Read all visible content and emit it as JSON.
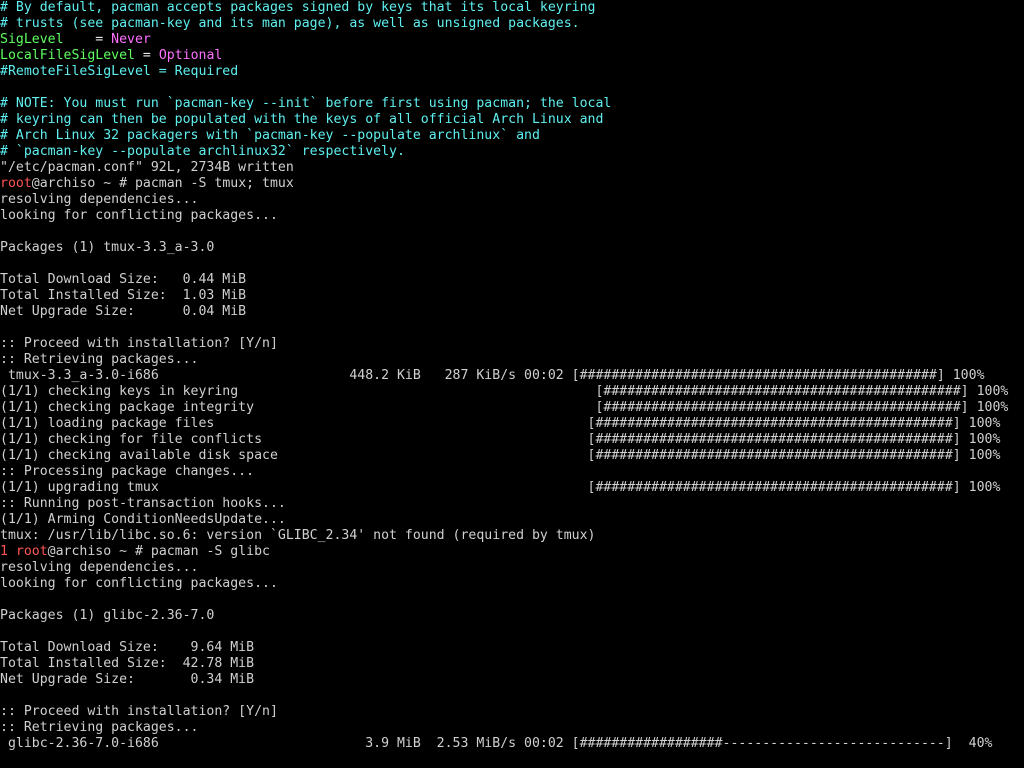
{
  "terminal": {
    "colors": {
      "background": "#000000",
      "foreground": "#d0d0d0",
      "comment": "#5ff0f0",
      "key": "#5fff5f",
      "value": "#ff70ff",
      "prompt_user": "#ff5555"
    },
    "config": {
      "comment1": "# By default, pacman accepts packages signed by keys that its local keyring",
      "comment2": "# trusts (see pacman-key and its man page), as well as unsigned packages.",
      "siglevel_key": "SigLevel",
      "siglevel_eq": "    = ",
      "siglevel_val": "Never",
      "localsig_key": "LocalFileSigLevel",
      "localsig_eq": " = ",
      "localsig_val": "Optional",
      "remotesig": "#RemoteFileSigLevel = Required",
      "note1": "# NOTE: You must run `pacman-key --init` before first using pacman; the local",
      "note2": "# keyring can then be populated with the keys of all official Arch Linux and",
      "note3": "# Arch Linux 32 packagers with `pacman-key --populate archlinux` and",
      "note4": "# `pacman-key --populate archlinux32` respectively.",
      "written": "\"/etc/pacman.conf\" 92L, 2734B written"
    },
    "cmd1": {
      "user": "root",
      "host_prompt": "@archiso ~ # ",
      "command": "pacman -S tmux; tmux"
    },
    "out1": {
      "resolving": "resolving dependencies...",
      "looking": "looking for conflicting packages...",
      "packages": "Packages (1) tmux-3.3_a-3.0",
      "dl_size": "Total Download Size:   0.44 MiB",
      "inst_size": "Total Installed Size:  1.03 MiB",
      "upg_size": "Net Upgrade Size:      0.04 MiB",
      "proceed": ":: Proceed with installation? [Y/n]",
      "retrieving": ":: Retrieving packages...",
      "download_line": " tmux-3.3_a-3.0-i686                        448.2 KiB   287 KiB/s 00:02 [#############################################] 100%",
      "keys": "(1/1) checking keys in keyring                                             [#############################################] 100%",
      "integrity": "(1/1) checking package integrity                                           [#############################################] 100%",
      "loading": "(1/1) loading package files                                               [#############################################] 100%",
      "conflicts": "(1/1) checking for file conflicts                                         [#############################################] 100%",
      "disk": "(1/1) checking available disk space                                       [#############################################] 100%",
      "processing": ":: Processing package changes...",
      "upgrading": "(1/1) upgrading tmux                                                      [#############################################] 100%",
      "hooks": ":: Running post-transaction hooks...",
      "arming": "(1/1) Arming ConditionNeedsUpdate...",
      "error": "tmux: /usr/lib/libc.so.6: version `GLIBC_2.34' not found (required by tmux)"
    },
    "cmd2": {
      "exit_code": "1",
      "user": "root",
      "host_prompt": "@archiso ~ # ",
      "command": "pacman -S glibc"
    },
    "out2": {
      "resolving": "resolving dependencies...",
      "looking": "looking for conflicting packages...",
      "packages": "Packages (1) glibc-2.36-7.0",
      "dl_size": "Total Download Size:    9.64 MiB",
      "inst_size": "Total Installed Size:  42.78 MiB",
      "upg_size": "Net Upgrade Size:       0.34 MiB",
      "proceed": ":: Proceed with installation? [Y/n]",
      "retrieving": ":: Retrieving packages...",
      "download_line": " glibc-2.36-7.0-i686                          3.9 MiB  2.53 MiB/s 00:02 [##################----------------------------]  40%"
    }
  }
}
